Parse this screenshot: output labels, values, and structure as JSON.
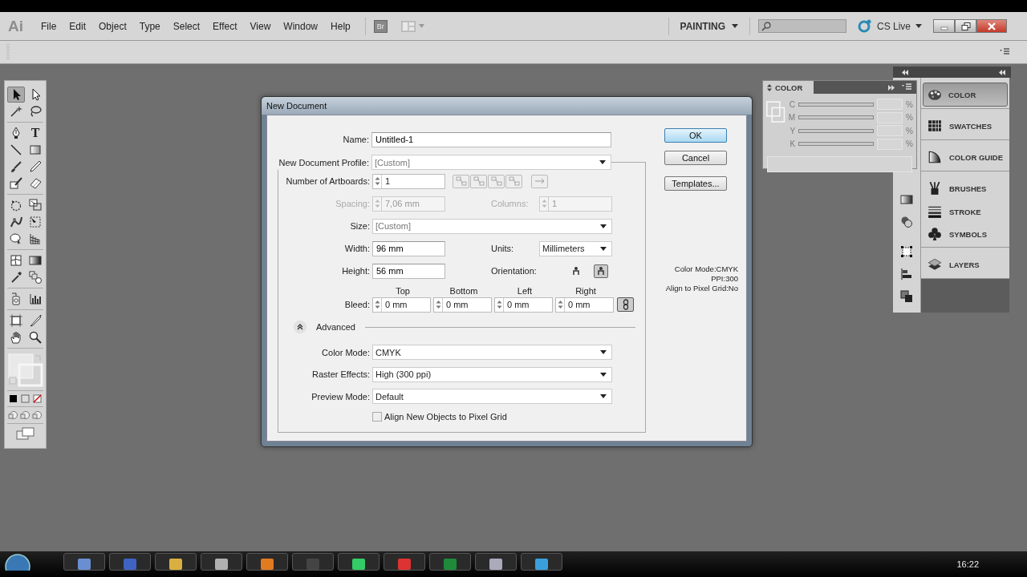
{
  "app": {
    "logo": "Ai",
    "menu": [
      "File",
      "Edit",
      "Object",
      "Type",
      "Select",
      "Effect",
      "View",
      "Window",
      "Help"
    ],
    "bridge": "Br",
    "workspace": "PAINTING",
    "cs_live": "CS Live"
  },
  "toolbox": {
    "type_tool": "T"
  },
  "color_panel": {
    "tab": "COLOR",
    "channels": [
      {
        "label": "C",
        "unit": "%"
      },
      {
        "label": "M",
        "unit": "%"
      },
      {
        "label": "Y",
        "unit": "%"
      },
      {
        "label": "K",
        "unit": "%"
      }
    ]
  },
  "dock": {
    "groups": [
      {
        "items": [
          {
            "label": "COLOR",
            "selected": true
          }
        ]
      },
      {
        "items": [
          {
            "label": "SWATCHES",
            "selected": false
          }
        ]
      },
      {
        "items": [
          {
            "label": "COLOR GUIDE",
            "selected": false
          }
        ]
      },
      {
        "items": [
          {
            "label": "BRUSHES",
            "selected": false
          },
          {
            "label": "STROKE",
            "selected": false
          },
          {
            "label": "SYMBOLS",
            "selected": false
          }
        ]
      },
      {
        "items": [
          {
            "label": "LAYERS",
            "selected": false
          }
        ]
      }
    ]
  },
  "dialog": {
    "title": "New Document",
    "name": {
      "label": "Name:",
      "value": "Untitled-1"
    },
    "profile": {
      "label": "New Document Profile:",
      "value": "[Custom]"
    },
    "artboards": {
      "label": "Number of Artboards:",
      "value": "1"
    },
    "spacing": {
      "label": "Spacing:",
      "value": "7,06 mm",
      "disabled": true
    },
    "columns": {
      "label": "Columns:",
      "value": "1",
      "disabled": true
    },
    "size": {
      "label": "Size:",
      "value": "[Custom]"
    },
    "width": {
      "label": "Width:",
      "value": "96 mm"
    },
    "units": {
      "label": "Units:",
      "value": "Millimeters"
    },
    "height": {
      "label": "Height:",
      "value": "56 mm"
    },
    "orientation": {
      "label": "Orientation:",
      "options": [
        {
          "selected": false
        },
        {
          "selected": true
        }
      ]
    },
    "bleed": {
      "label": "Bleed:",
      "linked": true,
      "fields": [
        {
          "heading": "Top",
          "value": "0 mm"
        },
        {
          "heading": "Bottom",
          "value": "0 mm"
        },
        {
          "heading": "Left",
          "value": "0 mm"
        },
        {
          "heading": "Right",
          "value": "0 mm"
        }
      ]
    },
    "advanced": {
      "label": "Advanced",
      "expanded": true
    },
    "color_mode": {
      "label": "Color Mode:",
      "value": "CMYK"
    },
    "raster_effects": {
      "label": "Raster Effects:",
      "value": "High (300 ppi)"
    },
    "preview_mode": {
      "label": "Preview Mode:",
      "value": "Default"
    },
    "align_pixel_grid": {
      "label": "Align New Objects to Pixel Grid",
      "checked": false
    },
    "buttons": [
      {
        "label": "OK",
        "default": true
      },
      {
        "label": "Cancel",
        "default": false
      },
      {
        "label": "Templates...",
        "default": false
      }
    ],
    "summary": [
      "Color Mode:CMYK",
      "PPI:300",
      "Align to Pixel Grid:No"
    ]
  },
  "taskbar": {
    "clock": "16:22"
  }
}
